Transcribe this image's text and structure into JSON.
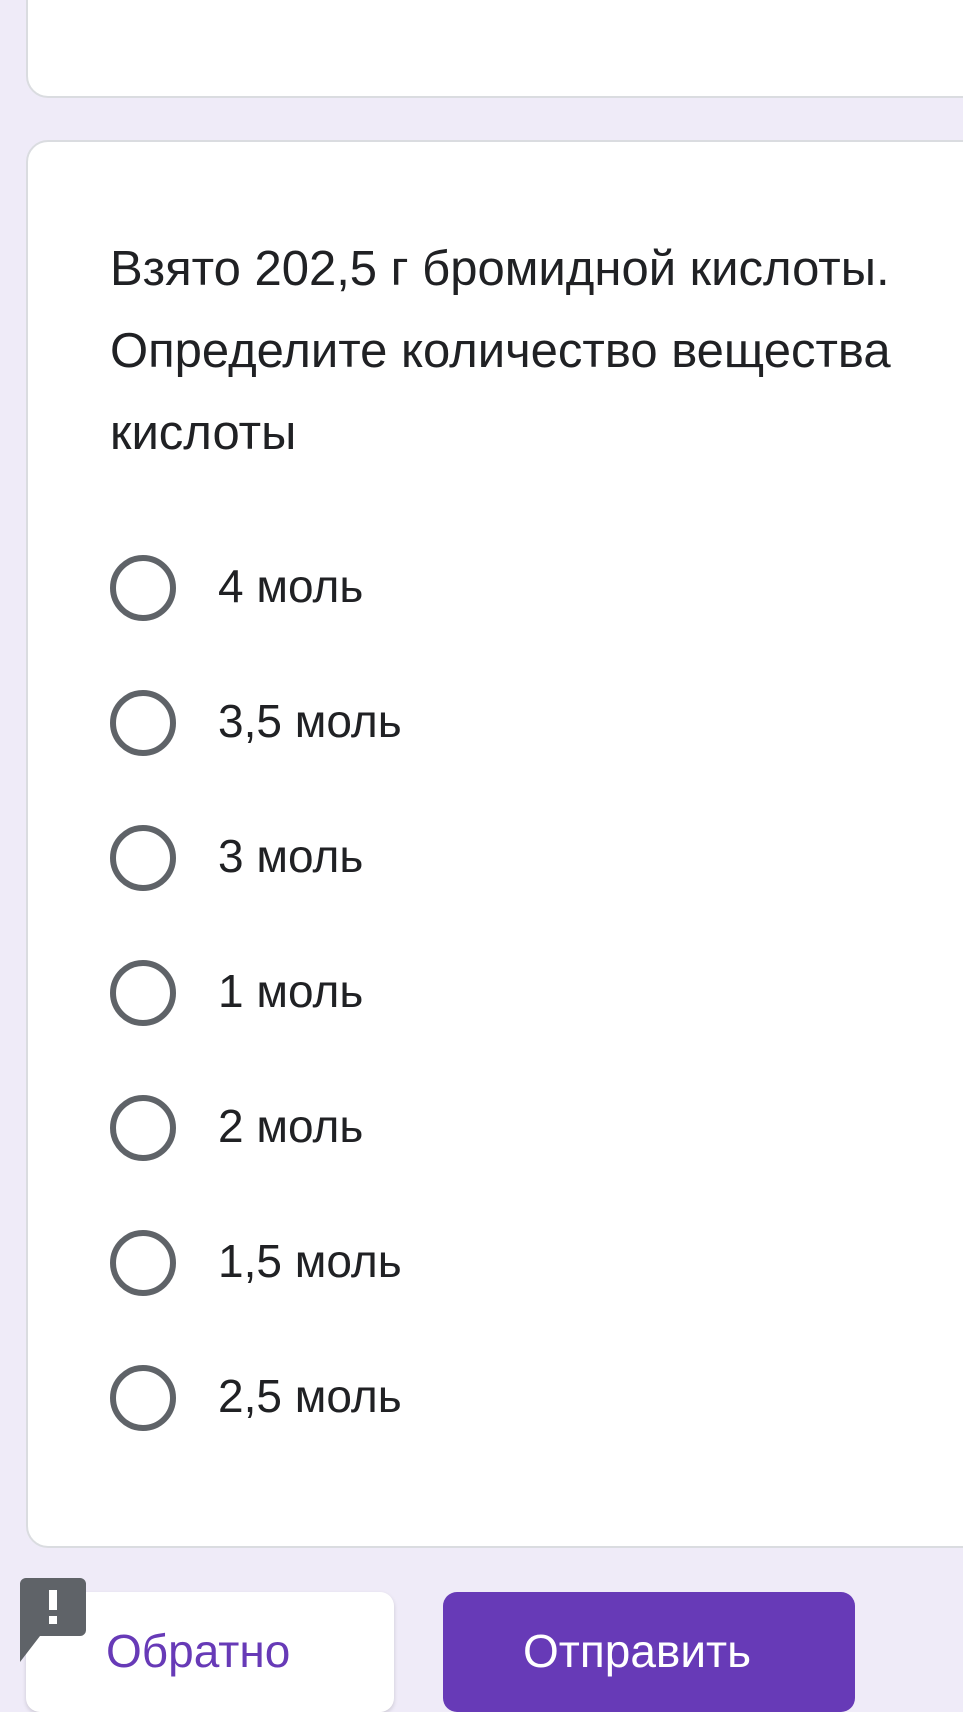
{
  "question": {
    "title": "Взято 202,5 г бромидной кислоты. Определите количество вещества кислоты",
    "options": [
      {
        "label": "4 моль"
      },
      {
        "label": "3,5 моль"
      },
      {
        "label": "3 моль"
      },
      {
        "label": "1 моль"
      },
      {
        "label": "2 моль"
      },
      {
        "label": "1,5 моль"
      },
      {
        "label": "2,5 моль"
      }
    ]
  },
  "footer": {
    "back_label": "Обратно",
    "submit_label": "Отправить"
  },
  "icons": {
    "report": "report-issue-icon"
  },
  "colors": {
    "background": "#efebf8",
    "accent": "#673ab7",
    "radio_border": "#5f6368",
    "text": "#202124"
  }
}
